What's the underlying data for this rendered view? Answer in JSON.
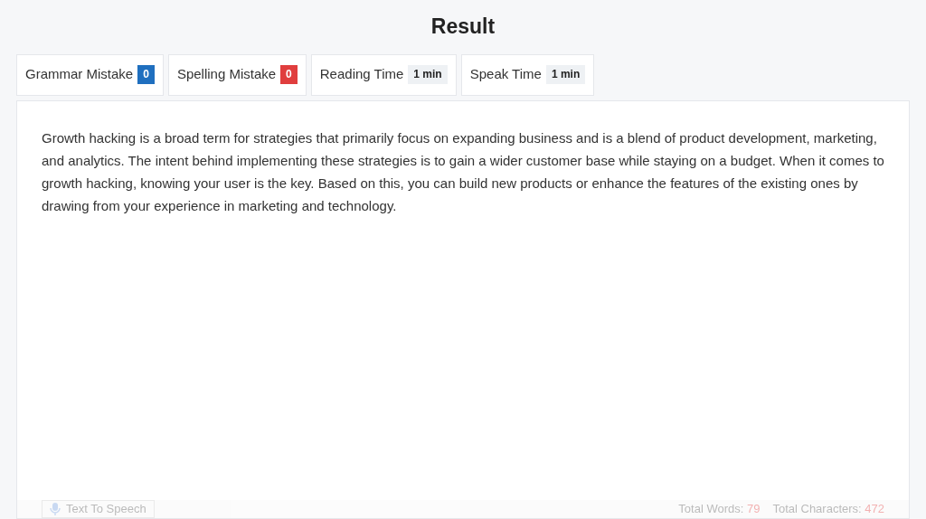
{
  "title": "Result",
  "stats": [
    {
      "label": "Grammar Mistake",
      "value": "0",
      "color": "#1f6fbf"
    },
    {
      "label": "Spelling Mistake",
      "value": "0",
      "color": "#e03e3e"
    },
    {
      "label": "Reading Time",
      "value": "1 min",
      "color": "#eef1f4"
    },
    {
      "label": "Speak Time",
      "value": "1 min",
      "color": "#eef1f4"
    }
  ],
  "result_text": "Growth hacking is a broad term for strategies that primarily focus on expanding business and is a blend of product development, marketing, and analytics. The intent behind implementing these strategies is to gain a wider customer base while staying on a budget. When it comes to growth hacking, knowing your user is the key. Based on this, you can build new products or enhance the features of the existing ones by drawing from your experience in marketing and technology.",
  "footer": {
    "button": "Text To Speech",
    "words_label": "Total Words:",
    "words": "79",
    "chars_label": "Total Characters:",
    "chars": "472"
  }
}
